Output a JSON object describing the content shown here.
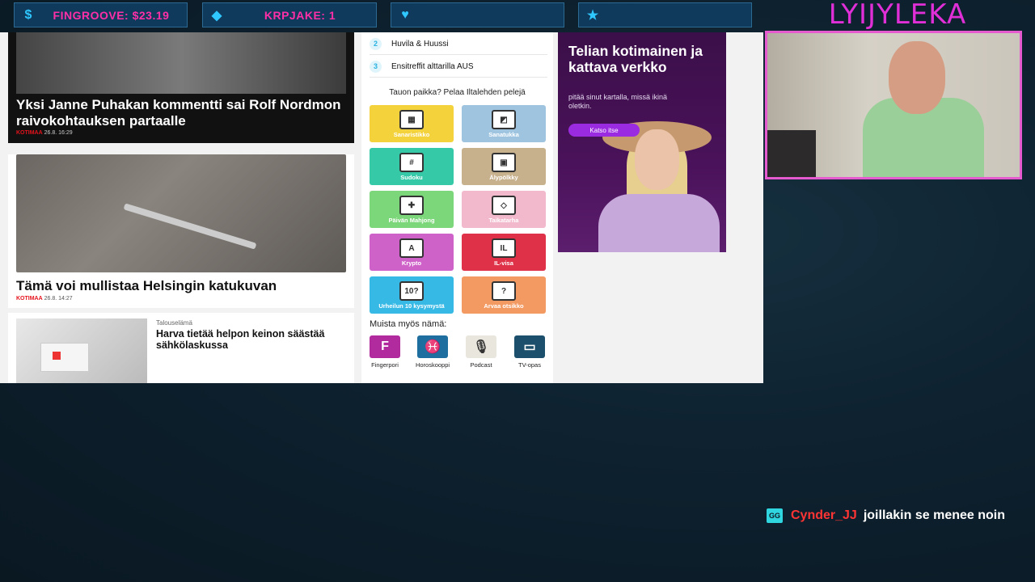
{
  "overlay": {
    "goals": [
      {
        "icon": "dollar-icon",
        "text": "FINGROOVE: $23.19"
      },
      {
        "icon": "diamond-icon",
        "text": "KRPJAKE: 1"
      },
      {
        "icon": "heart-icon",
        "text": ""
      },
      {
        "icon": "star-icon",
        "text": ""
      }
    ],
    "streamer_name": "LYIJYLEKA",
    "accent_color": "#e12fd8"
  },
  "articles": {
    "top": {
      "headline": "Yksi Janne Puhakan kommentti sai Rolf Nordmon raivokohtauksen partaalle",
      "category": "KOTIMAA",
      "time": "26.8. 16:29"
    },
    "second": {
      "headline": "Tämä voi mullistaa Helsingin katukuvan",
      "category": "KOTIMAA",
      "time": "26.8. 14:27"
    },
    "third": {
      "section": "Talouselämä",
      "headline": "Harva tietää helpon keinon säästää sähkölaskussa"
    }
  },
  "most_read": [
    {
      "num": "2",
      "title": "Huvila & Huussi"
    },
    {
      "num": "3",
      "title": "Ensitreffit alttarilla AUS"
    }
  ],
  "games": {
    "title": "Tauon paikka? Pelaa Iltalehden pelejä",
    "tiles": [
      {
        "label": "Sanaristikko",
        "color": "#f3d23c",
        "glyph": "▦"
      },
      {
        "label": "Sanatukka",
        "color": "#9ec4e0",
        "glyph": "◩"
      },
      {
        "label": "Sudoku",
        "color": "#36c9a8",
        "glyph": "#"
      },
      {
        "label": "Älypölkky",
        "color": "#c7b08c",
        "glyph": "▣"
      },
      {
        "label": "Päivän Mahjong",
        "color": "#7cd67a",
        "glyph": "✚"
      },
      {
        "label": "Taikatarha",
        "color": "#f2b9cc",
        "glyph": "◇"
      },
      {
        "label": "Krypto",
        "color": "#cf62c9",
        "glyph": "A"
      },
      {
        "label": "IL-visa",
        "color": "#df3148",
        "glyph": "IL"
      },
      {
        "label": "Urheilun 10 kysymystä",
        "color": "#37b9e6",
        "glyph": "10?"
      },
      {
        "label": "Arvaa otsikko",
        "color": "#f39a63",
        "glyph": "?"
      }
    ]
  },
  "remember": {
    "title": "Muista myös nämä:",
    "apps": [
      {
        "label": "Fingerpori",
        "color": "#b12b9e",
        "glyph": "F"
      },
      {
        "label": "Horoskooppi",
        "color": "#1e6fa0",
        "glyph": "♓"
      },
      {
        "label": "Podcast",
        "color": "#e9e6de",
        "glyph": "🎙"
      },
      {
        "label": "TV-opas",
        "color": "#1b4f6b",
        "glyph": "▭"
      }
    ]
  },
  "ad": {
    "headline": "Telian kotimainen ja kattava verkko",
    "sub": "pitää sinut kartalla, missä ikinä oletkin.",
    "button": "Katso itse"
  },
  "chat": {
    "badge": "GG",
    "user": "Cynder_JJ",
    "message": "joillakin se menee noin"
  }
}
